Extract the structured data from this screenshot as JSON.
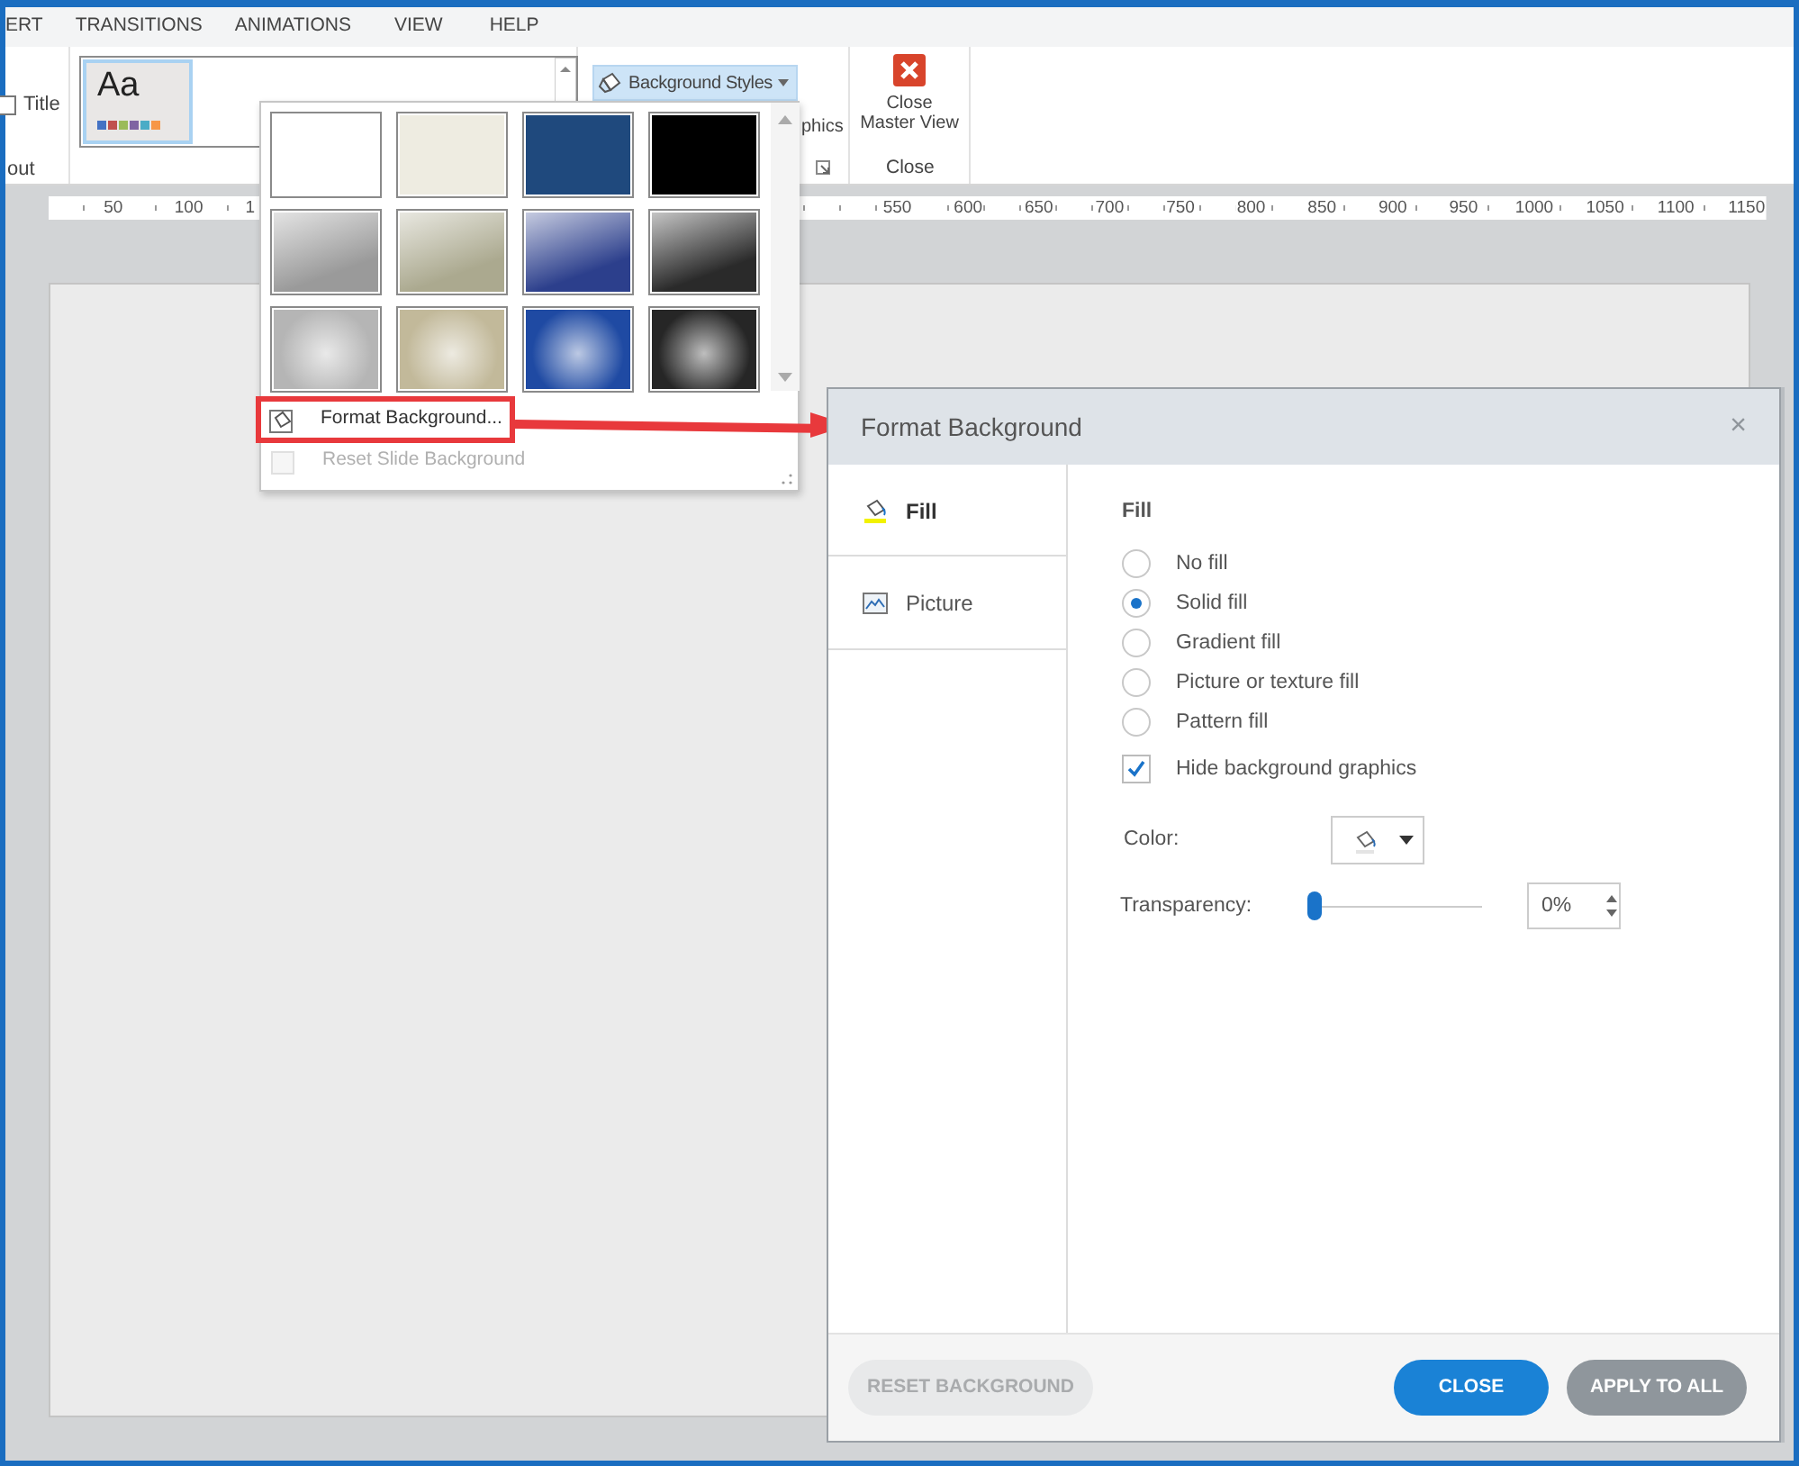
{
  "ribbon_tabs": [
    "ERT",
    "TRANSITIONS",
    "ANIMATIONS",
    "VIEW",
    "HELP"
  ],
  "ribbon": {
    "title_checkbox": {
      "label": "Title",
      "checked": false
    },
    "layout_label": "out",
    "theme_thumbnail": {
      "label": "Aa",
      "selected": true
    },
    "background_styles_button": "Background Styles",
    "graphics_label": "phics",
    "close_master_view": {
      "lines": [
        "Close",
        "Master View"
      ],
      "group_label": "Close"
    }
  },
  "ruler": {
    "left_labels": [
      "50",
      "100",
      "1"
    ],
    "right_labels": [
      "550",
      "600",
      "650",
      "700",
      "750",
      "800",
      "850",
      "900",
      "950",
      "1000",
      "1050",
      "1100",
      "1150"
    ]
  },
  "background_styles_menu": {
    "swatches": [
      {
        "kind": "flat",
        "color": "#ffffff"
      },
      {
        "kind": "flat",
        "color": "#eeece1"
      },
      {
        "kind": "flat",
        "color": "#1f497d"
      },
      {
        "kind": "flat",
        "color": "#000000"
      },
      {
        "kind": "linear",
        "color": "#9a9a9a"
      },
      {
        "kind": "linear",
        "color": "#aba98f"
      },
      {
        "kind": "linear",
        "color": "#2c3f8c"
      },
      {
        "kind": "linear",
        "color": "#2a2a2a"
      },
      {
        "kind": "radial",
        "color": "#b5b5b5"
      },
      {
        "kind": "radial",
        "color": "#c2b99a"
      },
      {
        "kind": "radial",
        "color": "#1f4aa3"
      },
      {
        "kind": "radial",
        "color": "#262626"
      }
    ],
    "items": [
      {
        "label": "Format Background...",
        "kind": "format",
        "disabled": false,
        "highlighted": true
      },
      {
        "label": "Reset Slide Background",
        "kind": "reset",
        "disabled": true,
        "highlighted": false
      }
    ]
  },
  "dialog": {
    "title": "Format Background",
    "close": "×",
    "nav": [
      {
        "label": "Fill",
        "kind": "fill",
        "selected": true
      },
      {
        "label": "Picture",
        "kind": "picture",
        "selected": false
      }
    ],
    "section_title": "Fill",
    "fill_options": [
      {
        "label": "No fill",
        "selected": false
      },
      {
        "label": "Solid fill",
        "selected": true
      },
      {
        "label": "Gradient fill",
        "selected": false
      },
      {
        "label": "Picture or texture fill",
        "selected": false
      },
      {
        "label": "Pattern fill",
        "selected": false
      }
    ],
    "hide_background_graphics": {
      "label": "Hide background graphics",
      "checked": true
    },
    "color": {
      "label": "Color:"
    },
    "transparency": {
      "label": "Transparency:",
      "level": 0,
      "reading": "0%"
    },
    "buttons": [
      {
        "label": "RESET BACKGROUND",
        "kind": "secondary",
        "disabled": true
      },
      {
        "label": "CLOSE",
        "kind": "primary",
        "disabled": false
      },
      {
        "label": "APPLY TO ALL",
        "kind": "neutral",
        "disabled": false
      }
    ]
  }
}
